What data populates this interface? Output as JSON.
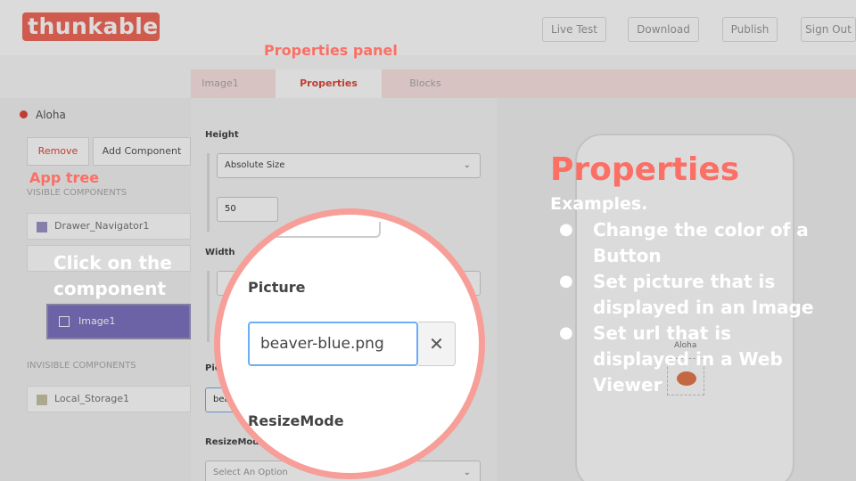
{
  "header": {
    "logo_text": "thunkable",
    "buttons": [
      "Live Test",
      "Download",
      "Publish",
      "Sign Out"
    ]
  },
  "tabs": {
    "image1": "Image1",
    "properties": "Properties",
    "blocks": "Blocks"
  },
  "left_panel": {
    "app_name": "Aloha",
    "remove_label": "Remove",
    "add_component_label": "Add Component",
    "visible_heading": "VISIBLE COMPONENTS",
    "visible_items": [
      "Drawer_Navigator1",
      "Image1"
    ],
    "invisible_heading": "INVISIBLE COMPONENTS",
    "invisible_items": [
      "Local_Storage1"
    ]
  },
  "properties_panel": {
    "height_label": "Height",
    "height_mode": "Absolute Size",
    "height_value": "50",
    "width_label": "Width",
    "picture_label_partial": "Pic",
    "picture_value_partial": "beav",
    "resize_label": "ResizeMode",
    "resize_placeholder": "Select An Option"
  },
  "preview": {
    "screen_title": "Aloha"
  },
  "annotations": {
    "properties_panel_caption": "Properties panel",
    "app_tree_caption": "App tree",
    "click_caption_line1": "Click on the",
    "click_caption_line2": "component",
    "heading": "Properties",
    "examples": "Examples.",
    "bullets": [
      [
        "Change the color of a",
        "Button"
      ],
      [
        "Set picture that is",
        "displayed in an Image"
      ],
      [
        "Set url that is",
        "displayed in a Web",
        "Viewer"
      ]
    ]
  },
  "magnifier": {
    "picture_label": "Picture",
    "picture_value": "beaver-blue.png",
    "clear_symbol": "✕",
    "resize_label": "ResizeMode"
  },
  "colors": {
    "accent": "#fb6f65",
    "selection": "#7d74c2",
    "focus": "#6aaef5"
  }
}
